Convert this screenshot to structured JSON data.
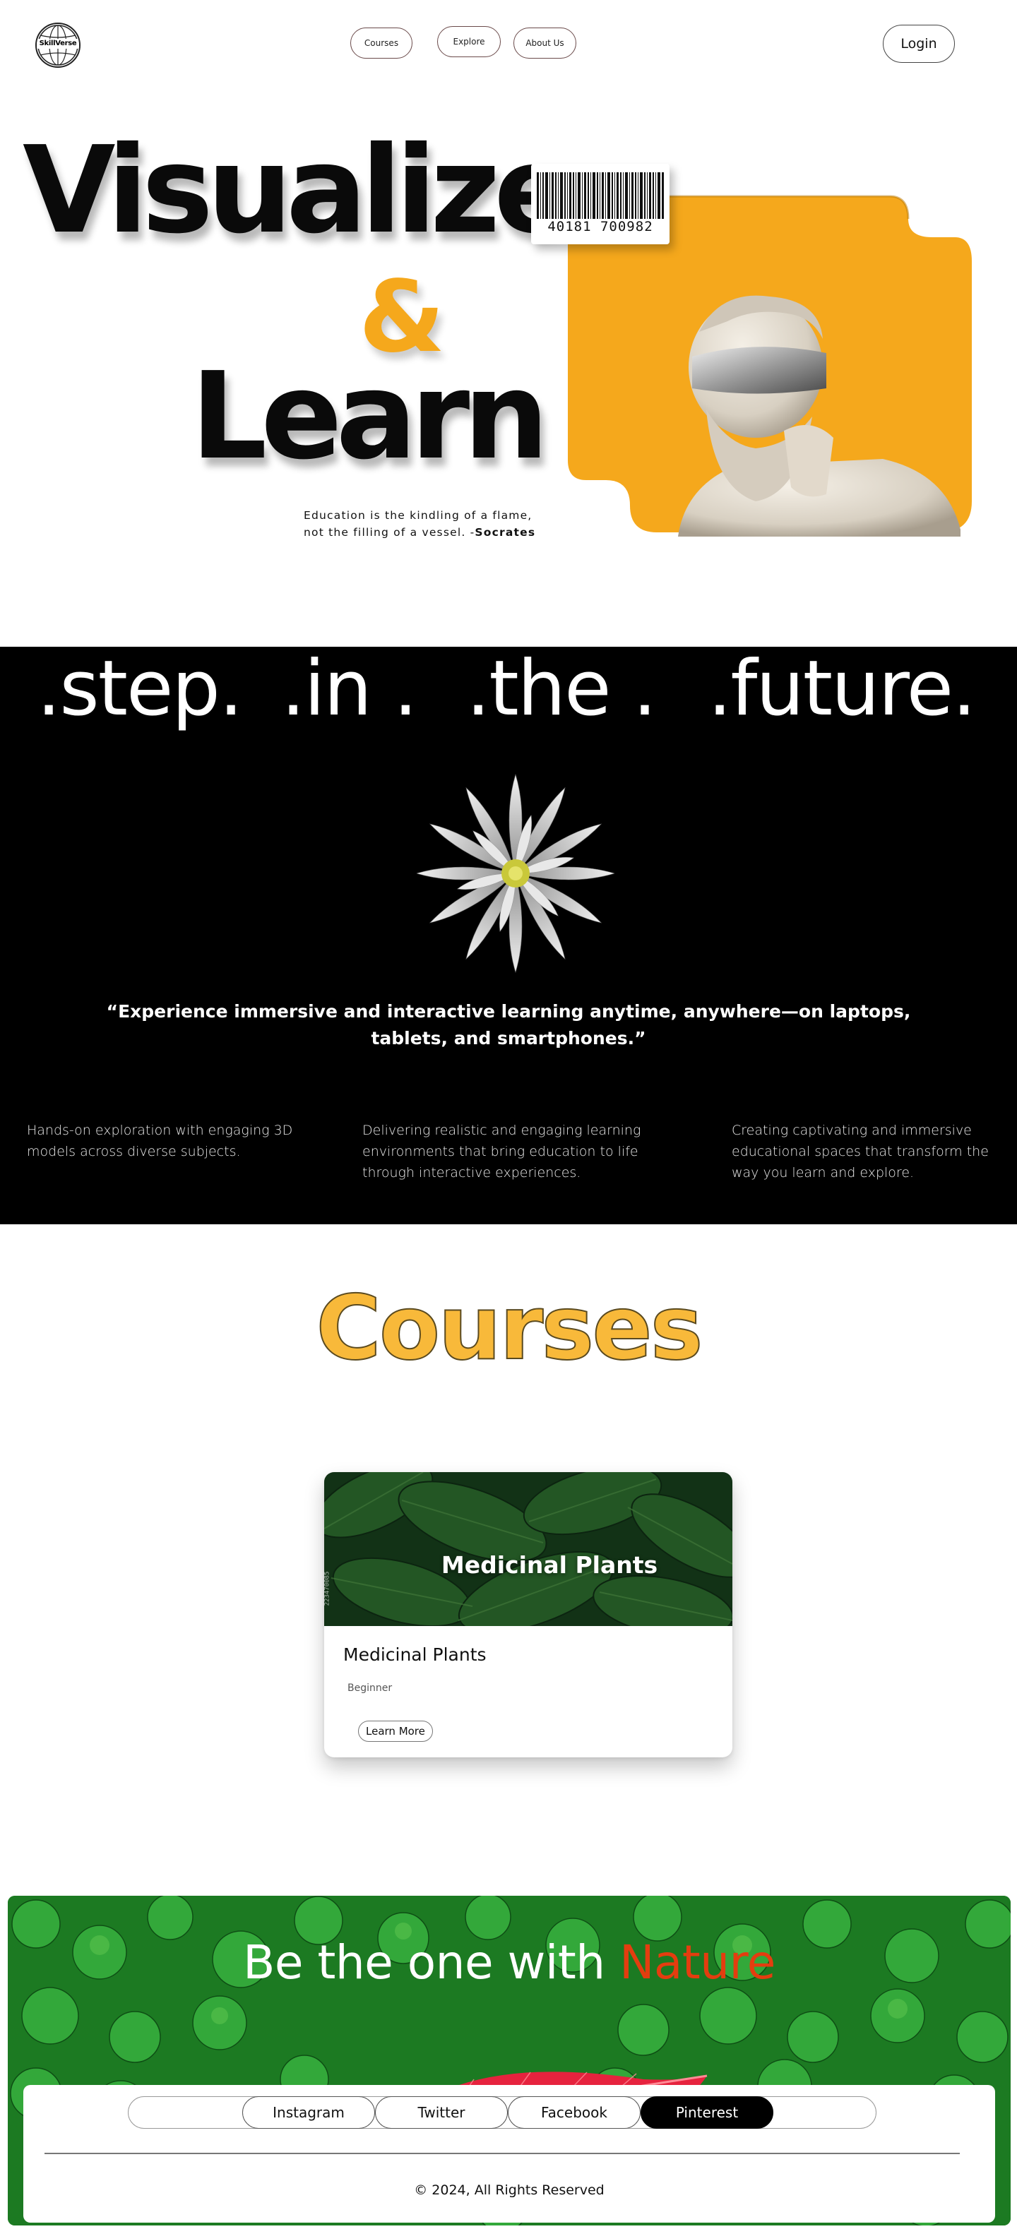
{
  "header": {
    "logo_text": "SkillVerse",
    "nav": [
      "Courses",
      "Explore",
      "About Us"
    ],
    "login_label": "Login"
  },
  "hero": {
    "word1": "Visualize",
    "ampersand": "&",
    "word2": "Learn",
    "barcode_number": "40181 700982",
    "quote_line1": "Education is the kindling of a flame,",
    "quote_line2": "not the filling of a vessel. -",
    "quote_author": "Socrates"
  },
  "band": {
    "words": [
      ".step.",
      ".in .",
      ".the .",
      ".future."
    ],
    "quote": "“Experience immersive and interactive learning anytime, anywhere—on laptops, tablets, and smartphones.”",
    "features": [
      "Hands-on exploration with engaging 3D models across diverse subjects.",
      "Delivering realistic and engaging learning environments that bring education to life through interactive experiences.",
      "Creating captivating and immersive educational spaces that transform the way you learn and explore."
    ]
  },
  "courses": {
    "title": "Courses",
    "card": {
      "image_title": "Medicinal Plants",
      "image_credit": "223470085",
      "name": "Medicinal Plants",
      "level": "Beginner",
      "button": "Learn More"
    }
  },
  "footer": {
    "title_prefix": "Be the one with ",
    "title_accent": "Nature",
    "social": [
      "Instagram",
      "Twitter",
      "Facebook",
      "Pinterest"
    ],
    "active_social": "Pinterest",
    "copyright": "© 2024, All Rights Reserved"
  },
  "colors": {
    "accent_orange": "#f5a81c",
    "nature_red": "#e43d0f",
    "band_black": "#000000"
  }
}
